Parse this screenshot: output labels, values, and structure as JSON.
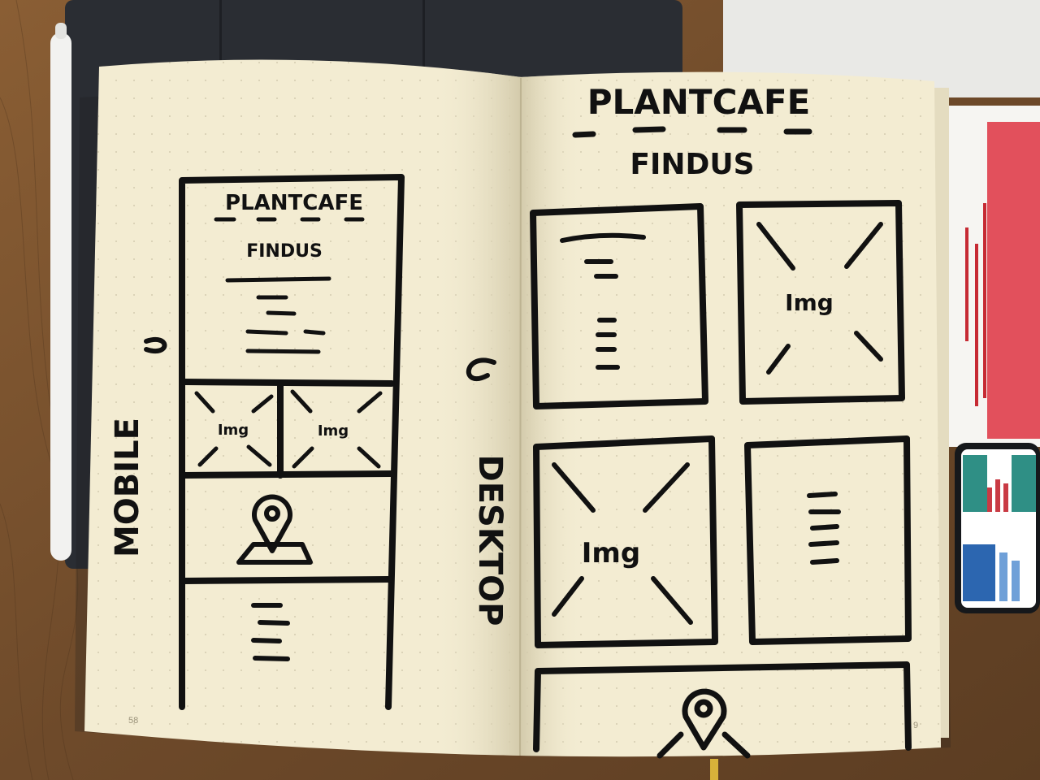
{
  "left_page": {
    "side_label": "MOBILE",
    "wireframe": {
      "title": "PLANTCAFE",
      "subtitle": "FINDUS",
      "image_labels": [
        "Img",
        "Img"
      ]
    },
    "page_number": "58"
  },
  "right_page": {
    "title": "PLANTCAFE",
    "subtitle": "FINDUS",
    "side_label": "DESKTOP",
    "image_labels": [
      "Img",
      "Img"
    ],
    "page_number": "9"
  },
  "colors": {
    "paper": "#f3ecd2",
    "ink": "#111111",
    "table": "#7a5330",
    "folio_cover": "#2a2d33"
  }
}
